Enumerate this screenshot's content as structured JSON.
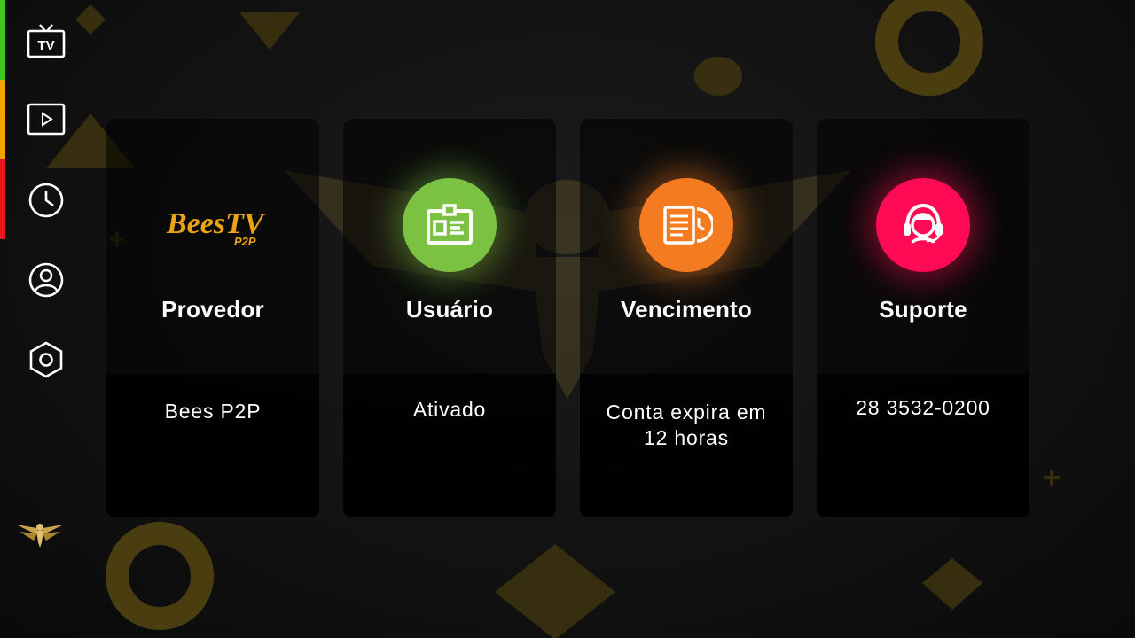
{
  "sidebar": {
    "items": [
      {
        "icon": "tv-icon",
        "label": "TV"
      },
      {
        "icon": "play-icon"
      },
      {
        "icon": "clock-icon"
      },
      {
        "icon": "user-icon"
      },
      {
        "icon": "settings-icon"
      }
    ],
    "accent_colors": [
      "#3cc81e",
      "#f2a500",
      "#e8141e"
    ]
  },
  "cards": [
    {
      "title": "Provedor",
      "value": "Bees P2P",
      "icon": "beestv-logo",
      "logo_main": "BeesTV",
      "logo_sub": "P2P",
      "color": "#e8a317"
    },
    {
      "title": "Usuário",
      "value": "Ativado",
      "icon": "id-card-icon",
      "color": "#7cc242"
    },
    {
      "title": "Vencimento",
      "value": "Conta expira em 12 horas",
      "icon": "expiry-document-icon",
      "color": "#f47b20"
    },
    {
      "title": "Suporte",
      "value": "28 3532-0200",
      "icon": "headset-support-icon",
      "color": "#ff0a54"
    }
  ]
}
